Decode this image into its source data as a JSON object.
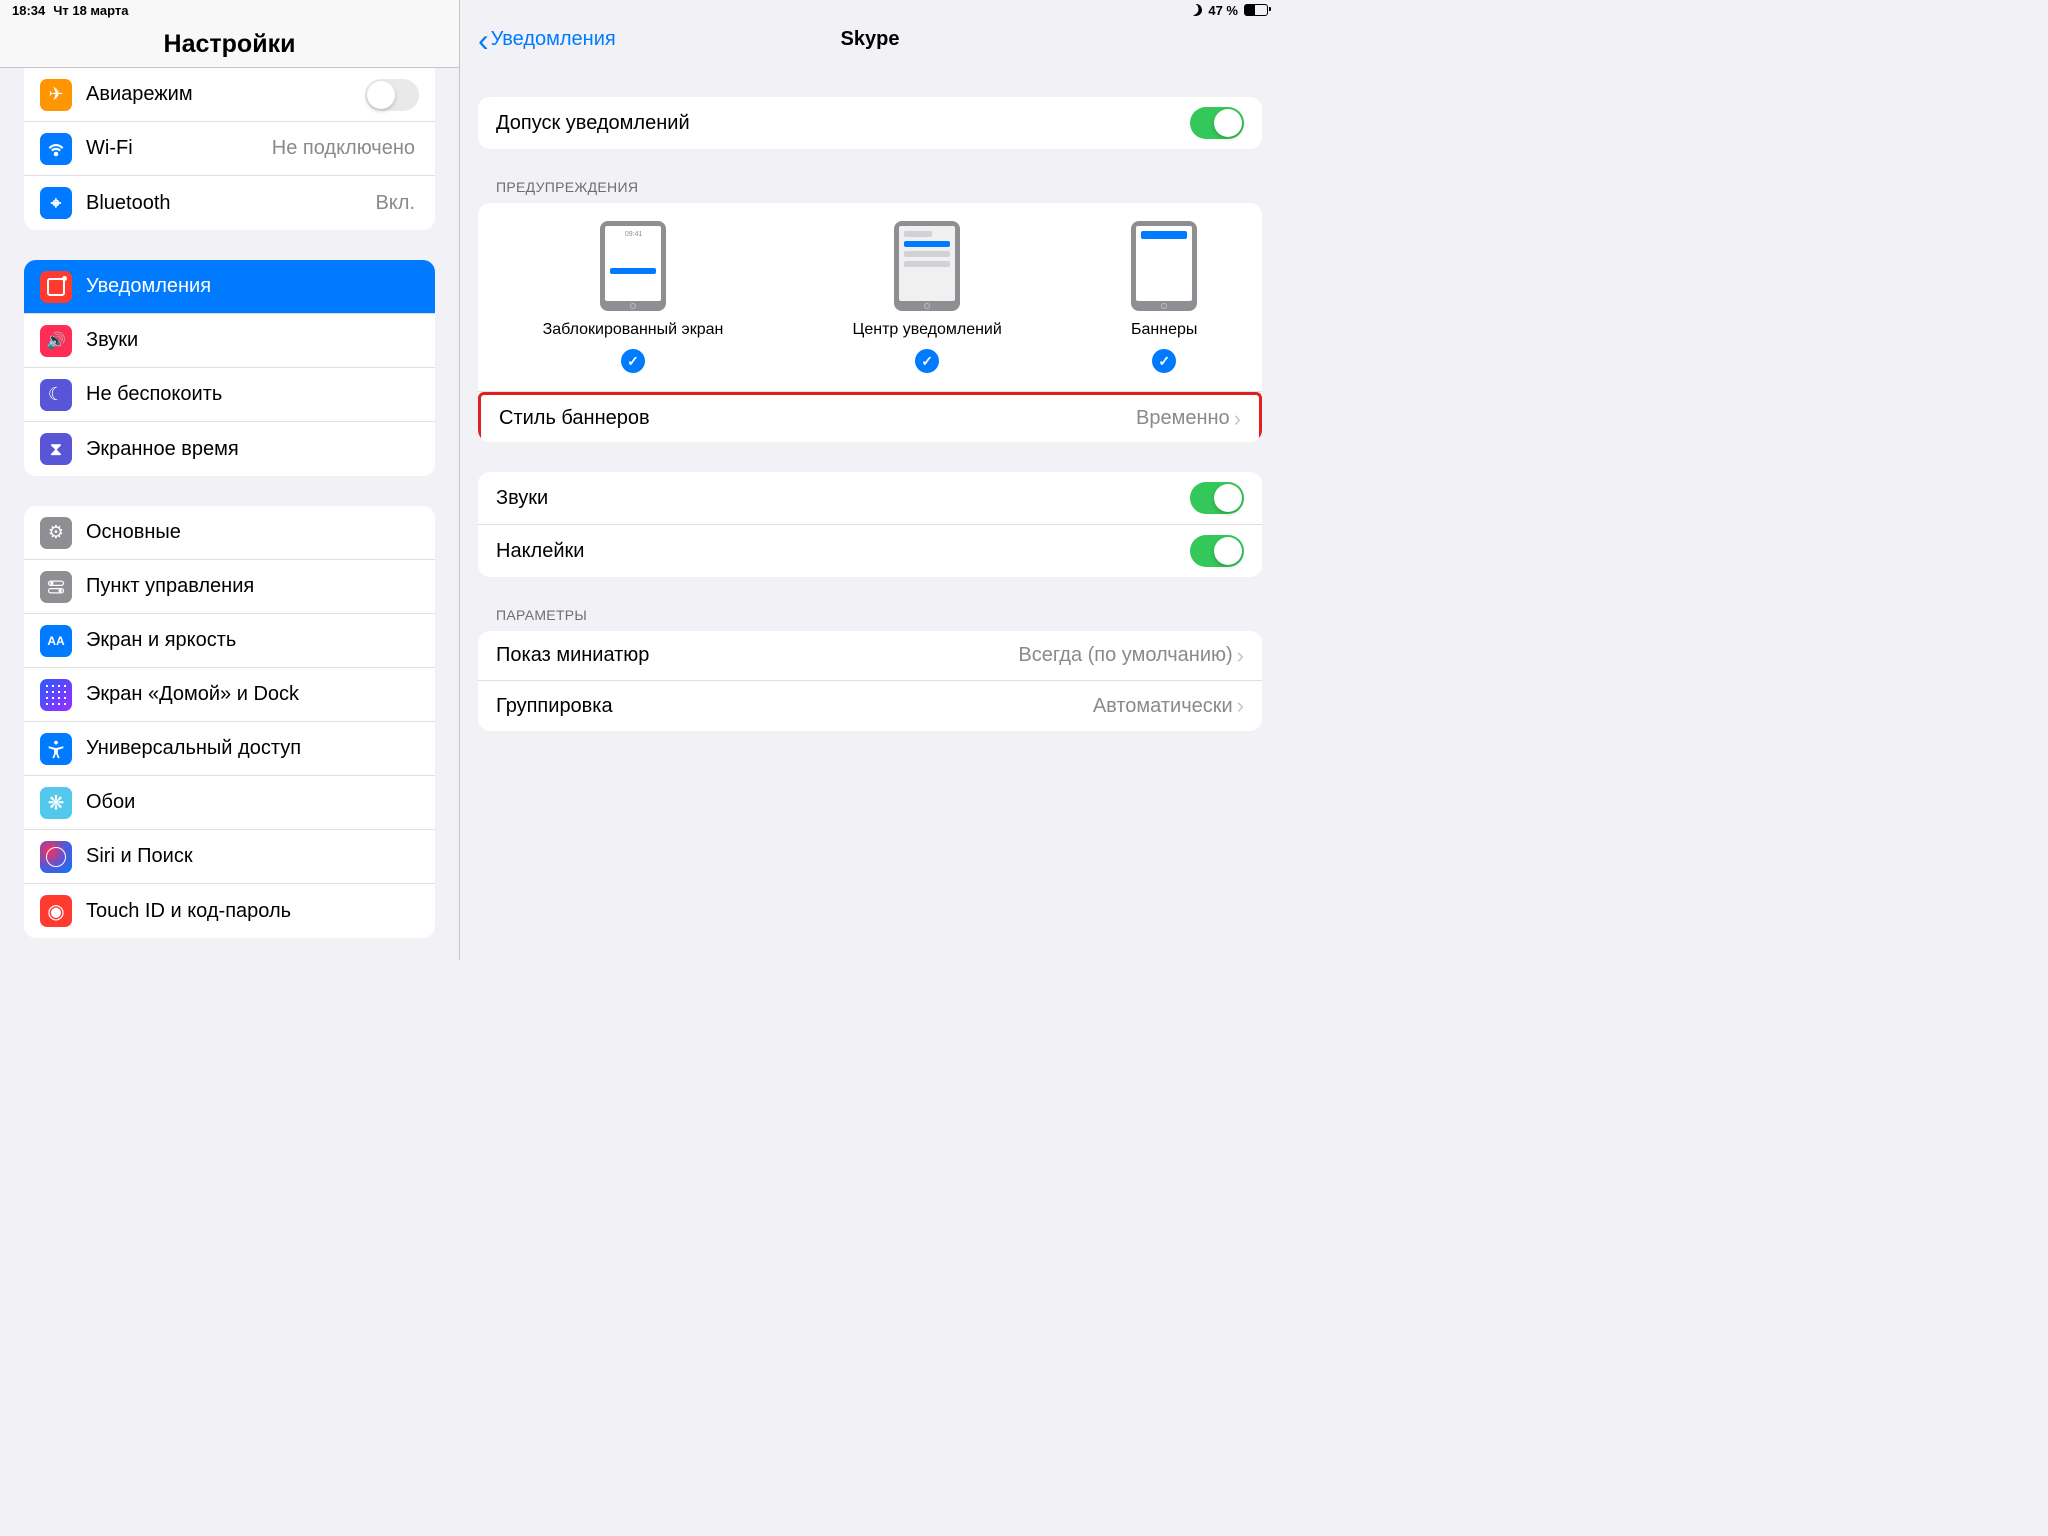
{
  "status": {
    "time": "18:34",
    "date": "Чт 18 марта",
    "battery": "47 %"
  },
  "sidebar": {
    "title": "Настройки",
    "g1": {
      "airplane": "Авиарежим",
      "wifi": "Wi-Fi",
      "wifi_val": "Не подключено",
      "bt": "Bluetooth",
      "bt_val": "Вкл."
    },
    "g2": {
      "notif": "Уведомления",
      "sound": "Звуки",
      "dnd": "Не беспокоить",
      "stime": "Экранное время"
    },
    "g3": {
      "general": "Основные",
      "control": "Пункт управления",
      "display": "Экран и яркость",
      "home": "Экран «Домой» и Dock",
      "access": "Универсальный доступ",
      "wallpaper": "Обои",
      "siri": "Siri и Поиск",
      "touchid": "Touch ID и код-пароль"
    }
  },
  "detail": {
    "back": "Уведомления",
    "title": "Skype",
    "allow": "Допуск уведомлений",
    "alerts_header": "ПРЕДУПРЕЖДЕНИЯ",
    "lock_label": "Заблокированный экран",
    "lock_time": "09:41",
    "center_label": "Центр уведомлений",
    "banner_label": "Баннеры",
    "banner_style": "Стиль баннеров",
    "banner_style_val": "Временно",
    "sounds": "Звуки",
    "badges": "Наклейки",
    "params_header": "ПАРАМЕТРЫ",
    "previews": "Показ миниатюр",
    "previews_val": "Всегда (по умолчанию)",
    "grouping": "Группировка",
    "grouping_val": "Автоматически"
  }
}
